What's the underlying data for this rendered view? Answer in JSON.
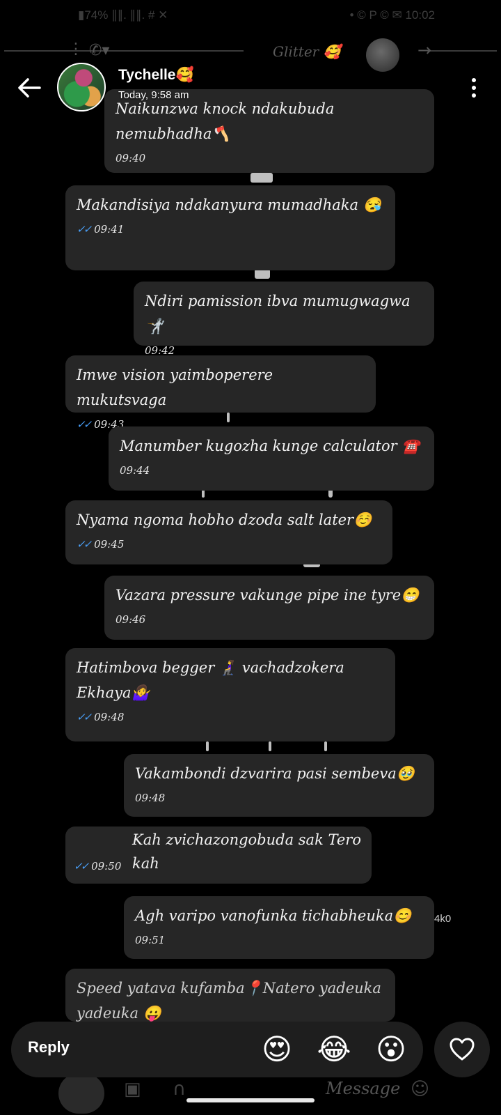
{
  "ghost_status": {
    "left": "▮74% ∥∥. ∥∥. # ✕",
    "right": "• © P © ✉ 10:02"
  },
  "ghost_toolbar": {
    "title": "Glitter 🥰"
  },
  "header": {
    "name": "Tychelle🥰",
    "time": "Today, 9:58 am"
  },
  "messages": [
    {
      "text": "Naikunzwa knock ndakubuda nemubhadha🪓",
      "time": "09:40",
      "read": false
    },
    {
      "text": "Makandisiya ndakanyura mumadhaka 😪",
      "time": "09:41",
      "read": true
    },
    {
      "text": "Ndiri pamission ibva mumugwagwa🤺",
      "time": "09:42",
      "read": false
    },
    {
      "text": "Imwe vision yaimboperere mukutsvaga",
      "time": "09:43",
      "read": true
    },
    {
      "text": "Manumber kugozha kunge calculator ☎️",
      "time": "09:44",
      "read": false
    },
    {
      "text": "Nyama ngoma hobho dzoda salt later☺️",
      "time": "09:45",
      "read": true
    },
    {
      "text": "Vazara pressure vakunge pipe ine tyre😁",
      "time": "09:46",
      "read": false
    },
    {
      "text": "Hatimbova begger 🧎‍♀️ vachadzokera Ekhaya🤷‍♀️",
      "time": "09:48",
      "read": true
    },
    {
      "text": "Vakambondi dzvarira pasi sembeva🥹",
      "time": "09:48",
      "read": false
    },
    {
      "text": "Kah zvichazongobuda sak Tero kah",
      "time": "09:50",
      "read": true
    },
    {
      "text": "Agh varipo vanofunka tichabheuka😊",
      "time": "09:51",
      "read": false
    },
    {
      "text": "Speed yatava kufamba📍Natero yadeuka yadeuka 😛",
      "time": "",
      "read": false
    }
  ],
  "side_text": "4k0",
  "reply": {
    "label": "Reply",
    "reactions": [
      "😍",
      "😂",
      "😮"
    ]
  },
  "ghost_composer": {
    "placeholder": "Message"
  },
  "icons": {
    "back": "back-arrow-icon",
    "more": "more-vertical-icon",
    "like": "heart-outline-icon"
  },
  "colors": {
    "bubble": "#262626",
    "read_tick": "#4aa3ff",
    "background": "#000000"
  }
}
